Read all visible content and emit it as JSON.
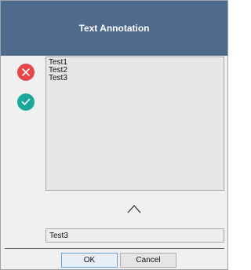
{
  "dialog": {
    "title": "Text Annotation"
  },
  "side_actions": [
    {
      "name": "reject",
      "icon": "close-icon",
      "color": "#e8474a"
    },
    {
      "name": "accept",
      "icon": "check-icon",
      "color": "#1aa89a"
    }
  ],
  "annotation_list": {
    "items": [
      "Test1",
      "Test2",
      "Test3"
    ]
  },
  "move_up_icon": "chevron-up-icon",
  "text_input": {
    "value": "Test3"
  },
  "buttons": {
    "ok_label": "OK",
    "cancel_label": "Cancel"
  },
  "colors": {
    "titlebar": "#4e6a8c",
    "panel": "#f0f0f0"
  }
}
